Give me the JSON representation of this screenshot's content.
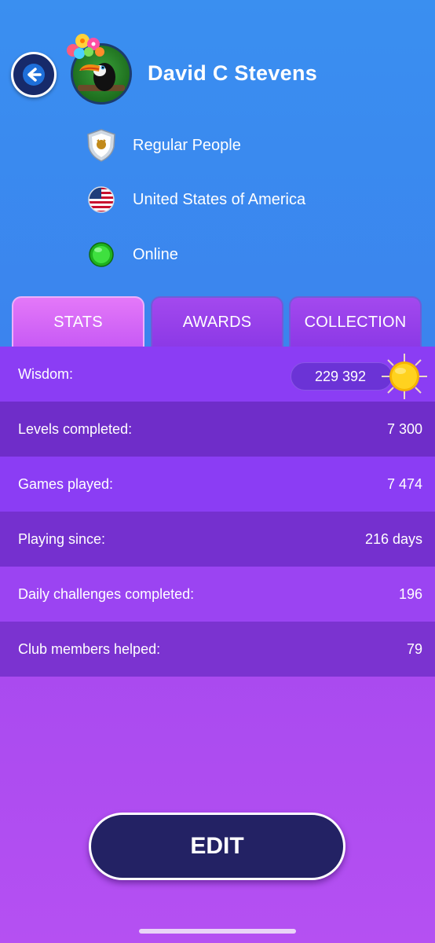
{
  "profile": {
    "name": "David C Stevens",
    "rank": "Regular People",
    "country": "United States of America",
    "status": "Online"
  },
  "tabs": [
    {
      "label": "STATS",
      "active": true
    },
    {
      "label": "AWARDS",
      "active": false
    },
    {
      "label": "COLLECTION",
      "active": false
    }
  ],
  "stats": [
    {
      "label": "Wisdom:",
      "value": "229 392"
    },
    {
      "label": "Levels completed:",
      "value": "7 300"
    },
    {
      "label": "Games played:",
      "value": "7 474"
    },
    {
      "label": "Playing since:",
      "value": "216 days"
    },
    {
      "label": "Daily challenges completed:",
      "value": "196"
    },
    {
      "label": "Club members helped:",
      "value": "79"
    }
  ],
  "actions": {
    "edit_label": "EDIT"
  },
  "colors": {
    "header_bg": "#3a8ff0",
    "body_bg": "#a548ee",
    "edit_button_bg": "#232264",
    "online_dot": "#22cc22"
  },
  "icons": {
    "back": "arrow-left-icon",
    "rank": "shield-icon",
    "country": "us-flag-icon",
    "status": "online-dot-icon",
    "wisdom": "sun-icon"
  }
}
